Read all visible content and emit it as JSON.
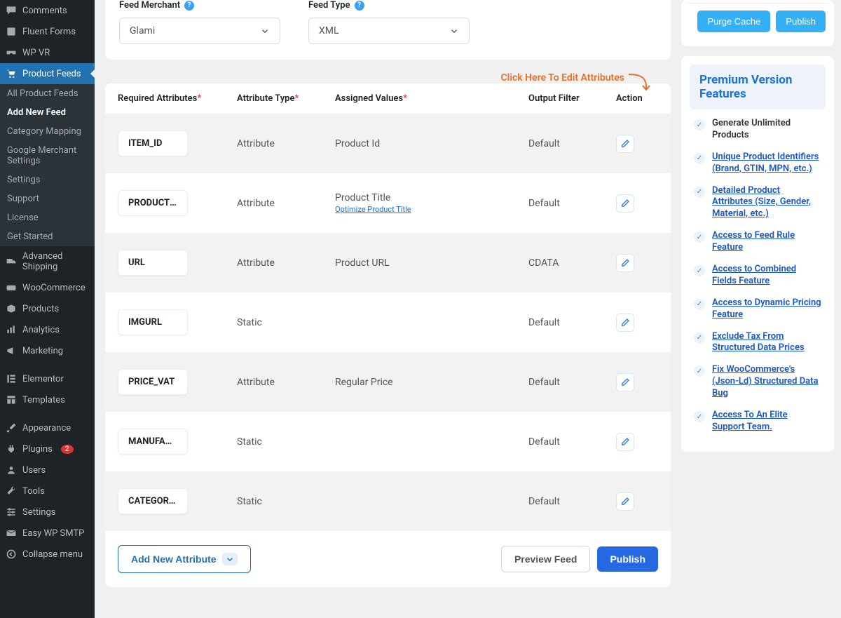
{
  "sidebar": {
    "items_top": [
      {
        "label": "Comments"
      },
      {
        "label": "Fluent Forms"
      },
      {
        "label": "WP VR"
      }
    ],
    "active": "Product Feeds",
    "sub": [
      {
        "label": "All Product Feeds"
      },
      {
        "label": "Add New Feed",
        "current": true
      },
      {
        "label": "Category Mapping"
      },
      {
        "label": "Google Merchant Settings"
      },
      {
        "label": "Settings"
      },
      {
        "label": "Support"
      },
      {
        "label": "License"
      },
      {
        "label": "Get Started"
      }
    ],
    "items_mid": [
      {
        "label": "Advanced Shipping"
      },
      {
        "label": "WooCommerce"
      },
      {
        "label": "Products"
      },
      {
        "label": "Analytics"
      },
      {
        "label": "Marketing"
      }
    ],
    "items_bot": [
      {
        "label": "Elementor"
      },
      {
        "label": "Templates"
      }
    ],
    "items_last": [
      {
        "label": "Appearance"
      },
      {
        "label": "Plugins",
        "badge": "2"
      },
      {
        "label": "Users"
      },
      {
        "label": "Tools"
      },
      {
        "label": "Settings"
      },
      {
        "label": "Easy WP SMTP"
      },
      {
        "label": "Collapse menu"
      }
    ]
  },
  "form": {
    "merchant_label": "Feed Merchant",
    "merchant_value": "Glami",
    "type_label": "Feed Type",
    "type_value": "XML",
    "edit_attr_link": "Click Here To Edit Attributes"
  },
  "table": {
    "headers": {
      "required": "Required Attributes",
      "type": "Attribute Type",
      "values": "Assigned Values",
      "filter": "Output Filter",
      "action": "Action"
    },
    "rows": [
      {
        "name": "ITEM_ID",
        "type": "Attribute",
        "value": "Product Id",
        "filter": "Default"
      },
      {
        "name": "PRODUCTNA...",
        "type": "Attribute",
        "value": "Product Title",
        "optimize": "Optimize Product Title",
        "filter": "Default"
      },
      {
        "name": "URL",
        "type": "Attribute",
        "value": "Product URL",
        "filter": "CDATA"
      },
      {
        "name": "IMGURL",
        "type": "Static",
        "value": "",
        "filter": "Default"
      },
      {
        "name": "PRICE_VAT",
        "type": "Attribute",
        "value": "Regular Price",
        "filter": "Default"
      },
      {
        "name": "MANUFACTU...",
        "type": "Static",
        "value": "",
        "filter": "Default"
      },
      {
        "name": "CATEGORYT...",
        "type": "Static",
        "value": "",
        "filter": "Default"
      }
    ],
    "footer": {
      "add": "Add New Attribute",
      "preview": "Preview Feed",
      "publish": "Publish"
    }
  },
  "right": {
    "purge": "Purge Cache",
    "publish": "Publish",
    "premium_title": "Premium Version Features",
    "features": [
      {
        "label": "Generate Unlimited Products",
        "link": false
      },
      {
        "label": "Unique Product Identifiers (Brand, GTIN, MPN, etc.)",
        "link": true
      },
      {
        "label": "Detailed Product Attributes (Size, Gender, Material, etc.)",
        "link": true
      },
      {
        "label": "Access to Feed Rule Feature",
        "link": true
      },
      {
        "label": "Access to Combined Fields Feature",
        "link": true
      },
      {
        "label": "Access to Dynamic Pricing Feature",
        "link": true
      },
      {
        "label": "Exclude Tax From Structured Data Prices",
        "link": true
      },
      {
        "label": "Fix WooCommerce's (Json-Ld) Structured Data Bug",
        "link": true
      },
      {
        "label": "Access To An Elite Support Team.",
        "link": true
      }
    ]
  }
}
